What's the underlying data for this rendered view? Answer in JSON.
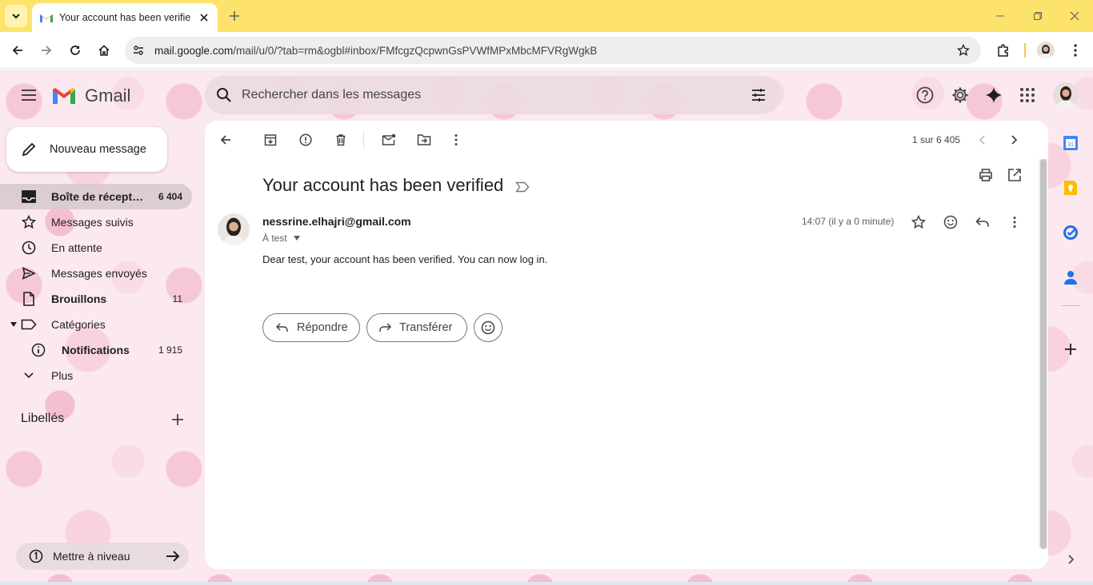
{
  "browser": {
    "tab_title": "Your account has been verified",
    "url_host": "mail.google.com",
    "url_path": "/mail/u/0/?tab=rm&ogbl#inbox/FMfcgzQcpwnGsPVWfMPxMbcMFVRgWgkB"
  },
  "gmail": {
    "logo_text": "Gmail",
    "search_placeholder": "Rechercher dans les messages",
    "compose_label": "Nouveau message",
    "nav": [
      {
        "label": "Boîte de récept…",
        "count": "6 404"
      },
      {
        "label": "Messages suivis",
        "count": ""
      },
      {
        "label": "En attente",
        "count": ""
      },
      {
        "label": "Messages envoyés",
        "count": ""
      },
      {
        "label": "Brouillons",
        "count": "11"
      },
      {
        "label": "Catégories",
        "count": ""
      },
      {
        "label": "Notifications",
        "count": "1 915"
      },
      {
        "label": "Plus",
        "count": ""
      }
    ],
    "labels_title": "Libellés",
    "upgrade_label": "Mettre à niveau"
  },
  "message": {
    "pager": "1 sur 6 405",
    "subject": "Your account has been verified",
    "sender": "nessrine.elhajri@gmail.com",
    "to": "À test",
    "time": "14:07 (il y a 0 minute)",
    "body": "Dear test, your account has been verified. You can now log in.",
    "reply_label": "Répondre",
    "forward_label": "Transférer"
  },
  "colors": {
    "tabstrip": "#fde36b",
    "gmail_red": "#ea4335",
    "gmail_blue": "#4285f4",
    "gmail_green": "#34a853",
    "gmail_yellow": "#fbbc04"
  },
  "icons": [
    "chevron-down-icon",
    "gmail-favicon-icon",
    "close-icon",
    "plus-icon",
    "back-icon",
    "forward-icon",
    "reload-icon",
    "home-icon",
    "site-settings-icon",
    "star-icon",
    "extensions-icon",
    "more-vert-icon",
    "hamburger-icon",
    "search-icon",
    "filter-icon",
    "help-icon",
    "gear-icon",
    "gemini-icon",
    "apps-icon",
    "pencil-icon",
    "inbox-icon",
    "clock-icon",
    "send-icon",
    "draft-icon",
    "label-icon",
    "info-icon",
    "archive-icon",
    "spam-icon",
    "trash-icon",
    "mark-unread-icon",
    "move-to-icon",
    "print-icon",
    "open-new-window-icon",
    "emoji-icon",
    "reply-icon",
    "calendar-icon",
    "keep-icon",
    "tasks-icon",
    "contacts-icon"
  ]
}
